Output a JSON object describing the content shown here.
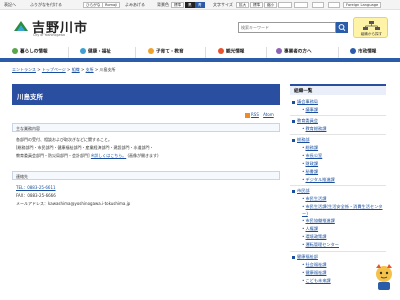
{
  "util": {
    "items": [
      "表記へ",
      "ふりがなを付ける",
      "ひらがな",
      "Romaji",
      "よみあげる"
    ],
    "bg_label": "背景色",
    "bg_options": [
      "標準",
      "黒",
      "青"
    ],
    "font_label": "文字サイズ",
    "font_options": [
      "拡大",
      "標準",
      "縮小"
    ],
    "lang": "Foreign Language"
  },
  "header": {
    "title": "吉野川市",
    "subtitle": "City of Yoshinogawa",
    "search_placeholder": "検索キーワード",
    "org_button": "組織から探す"
  },
  "nav": [
    {
      "label": "暮らしの情報",
      "color": "#5aa64b"
    },
    {
      "label": "健康・福祉",
      "color": "#3e9fd1"
    },
    {
      "label": "子育て・教育",
      "color": "#f0a32b"
    },
    {
      "label": "観光情報",
      "color": "#e6542f"
    },
    {
      "label": "事業者の方へ",
      "color": "#8e63b7"
    },
    {
      "label": "市政情報",
      "color": "#2a5caa"
    }
  ],
  "breadcrumb": {
    "items": [
      "エントランス",
      "トップページ",
      "組織",
      "支所",
      "川島支所"
    ],
    "separator": ">"
  },
  "main": {
    "title": "川島支所",
    "rss": "RSS",
    "atom": "Atom",
    "section1_title": "主な業務内容",
    "body": [
      "各部門の受付、相談および取次ぎなどに関すること。",
      "[総務部門・市民部門・健康福祉部門・産業経済部門・建設部門・水道部門・",
      "教育委員会部門・防災局部門・会計部門]"
    ],
    "detail_link": "※詳しくはこちら。",
    "detail_note": "(画像が開きます)",
    "section2_title": "連絡先",
    "tel": "TEL：0883-25-6611",
    "fax": "FAX：0883-25-6666",
    "mail": "メールアドレス：kawashima@yoshinogawa.i-tokushima.jp"
  },
  "sidebar": {
    "title": "組織一覧",
    "groups": [
      {
        "label": "議会事務局",
        "children": [
          "議事課"
        ]
      },
      {
        "label": "教育委員会",
        "children": [
          "教育総務課"
        ]
      },
      {
        "label": "総務部",
        "children": [
          "総務課",
          "市長公室",
          "財政課",
          "秘書課",
          "デジタル推進課"
        ]
      },
      {
        "label": "市民部",
        "children": [
          "市民生活課",
          "市民生活課(生活安全係・消費生活センター)",
          "市民協働推進課",
          "人権課",
          "環境政策課",
          "運転管理センター"
        ]
      },
      {
        "label": "健康福祉部",
        "children": [
          "社会福祉課",
          "健康福祉課",
          "こども未来課"
        ]
      }
    ]
  }
}
